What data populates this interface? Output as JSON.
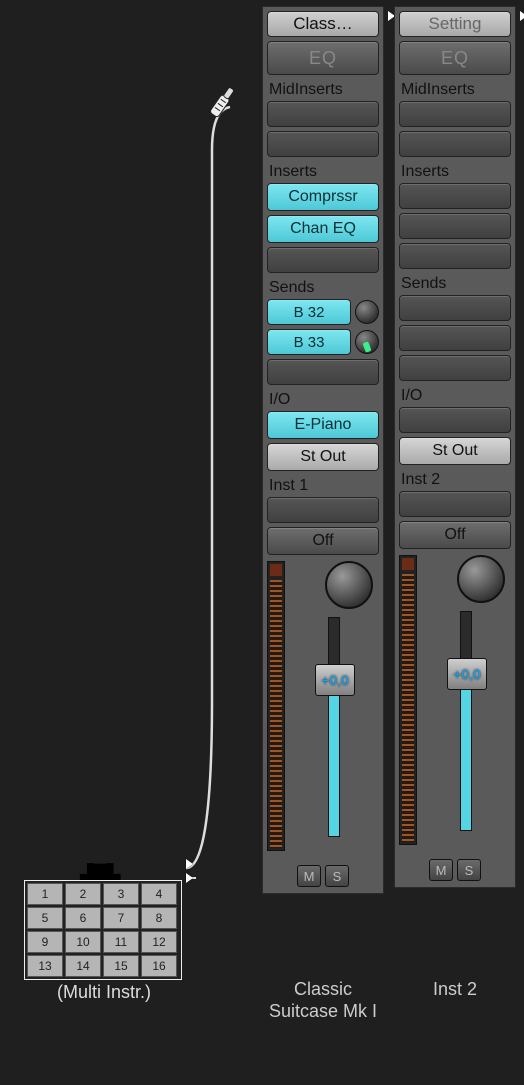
{
  "multi": {
    "label": "(Multi Instr.)",
    "cells": [
      "1",
      "2",
      "3",
      "4",
      "5",
      "6",
      "7",
      "8",
      "9",
      "10",
      "11",
      "12",
      "13",
      "14",
      "15",
      "16"
    ]
  },
  "strips": [
    {
      "setting": "Class…",
      "eq": "EQ",
      "midinserts_label": "MidInserts",
      "inserts_label": "Inserts",
      "inserts": [
        "Comprssr",
        "Chan EQ"
      ],
      "sends_label": "Sends",
      "sends": [
        "B 32",
        "B 33"
      ],
      "io_label": "I/O",
      "io_in": "E-Piano",
      "io_out": "St Out",
      "group_label": "Inst 1",
      "auto": "Off",
      "fader_value": "+0,0",
      "mute": "M",
      "solo": "S",
      "name": "Classic Suitcase Mk I"
    },
    {
      "setting": "Setting",
      "eq": "EQ",
      "midinserts_label": "MidInserts",
      "inserts_label": "Inserts",
      "inserts": [],
      "sends_label": "Sends",
      "sends": [],
      "io_label": "I/O",
      "io_in": "",
      "io_out": "St Out",
      "group_label": "Inst 2",
      "auto": "Off",
      "fader_value": "+0,0",
      "mute": "M",
      "solo": "S",
      "name": "Inst 2"
    }
  ]
}
